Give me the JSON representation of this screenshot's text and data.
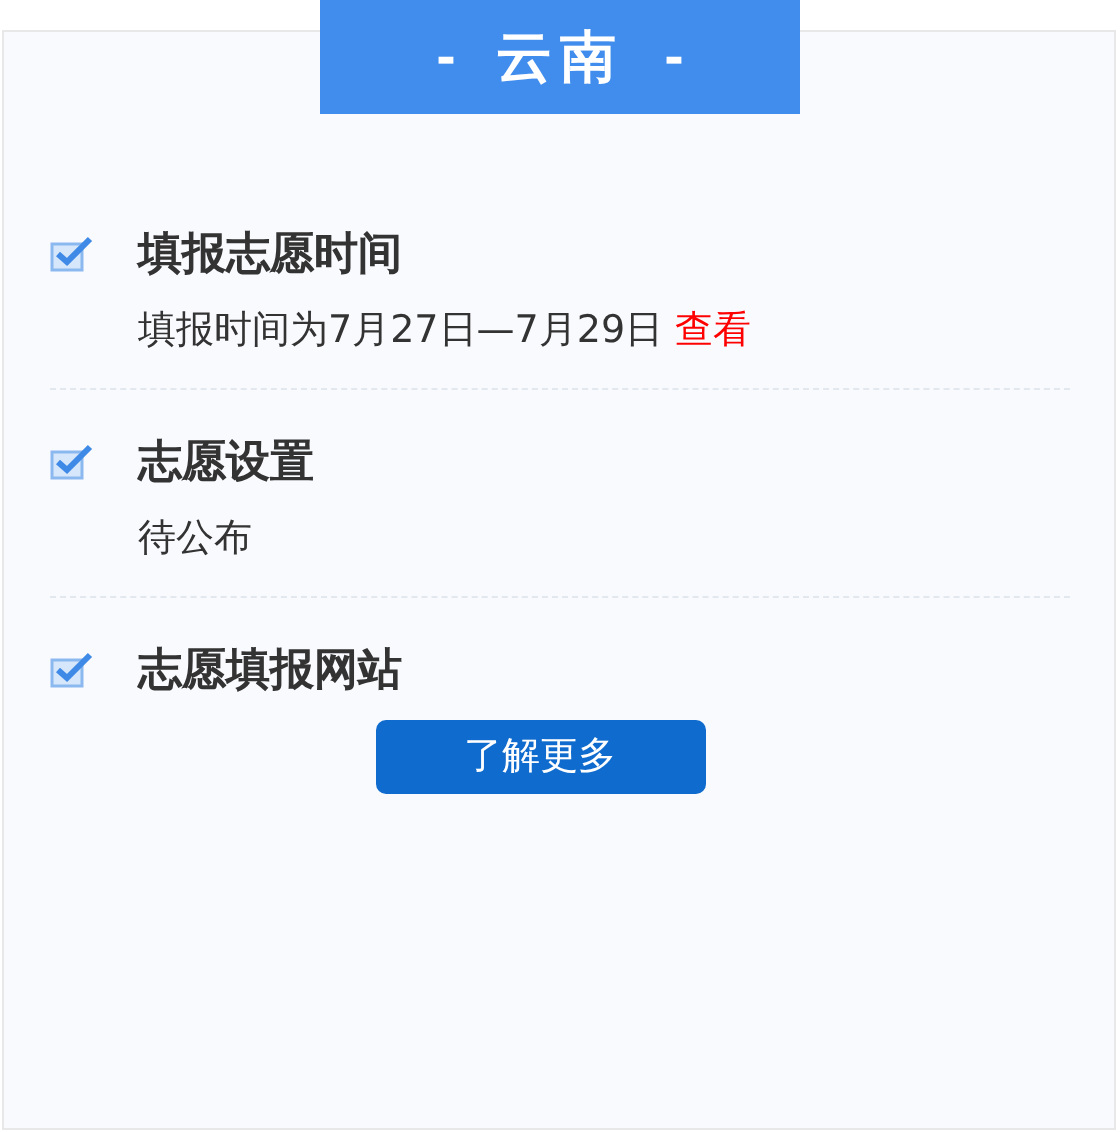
{
  "header": {
    "left_mark": "-",
    "title": "云南",
    "right_mark": "-"
  },
  "sections": [
    {
      "title": "填报志愿时间",
      "kind": "text",
      "text": "填报时间为7月27日—7月29日",
      "link": "查看"
    },
    {
      "title": "志愿设置",
      "kind": "text",
      "text": "待公布"
    },
    {
      "title": "志愿填报网站",
      "kind": "button",
      "button": "了解更多"
    }
  ]
}
